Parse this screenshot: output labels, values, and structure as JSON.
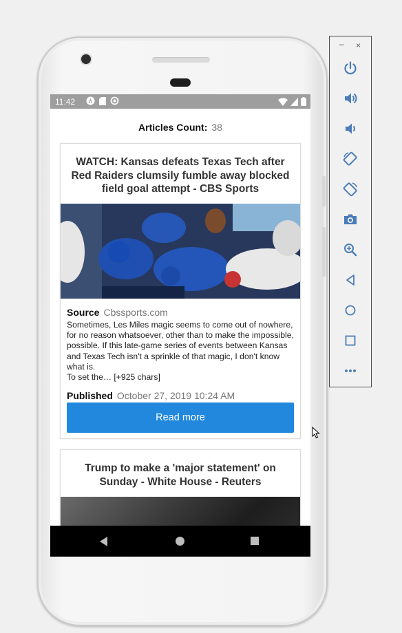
{
  "status_bar": {
    "time": "11:42",
    "icons": [
      "a-icon",
      "sd-card-icon",
      "data-saver-icon",
      "wifi-icon",
      "signal-icon",
      "battery-icon"
    ]
  },
  "header": {
    "count_label": "Articles Count:",
    "count_value": "38"
  },
  "articles": [
    {
      "title": "WATCH: Kansas defeats Texas Tech after Red Raiders clumsily fumble away blocked field goal attempt - CBS Sports",
      "source_label": "Source",
      "source_value": "Cbssports.com",
      "description": "Sometimes, Les Miles magic seems to come out of nowhere, for no reason whatsoever, other than to make the impossible, possible. If this late-game series of events between Kansas and Texas Tech isn't a sprinkle of that magic, I don't know what is.",
      "description_more": "To set the… [+925 chars]",
      "published_label": "Published",
      "published_value": "October 27, 2019 10:24 AM",
      "button_label": "Read more"
    },
    {
      "title": "Trump to make a 'major statement' on Sunday - White House - Reuters"
    }
  ],
  "colors": {
    "accent": "#2188dd",
    "status_bar": "#9e9e9e",
    "nav_bar": "#000000"
  },
  "emulator_toolbar": {
    "window_controls": [
      "minimize-icon",
      "close-icon"
    ],
    "minimize": "–",
    "close": "×",
    "buttons": [
      "power-icon",
      "volume-up-icon",
      "volume-down-icon",
      "rotate-left-icon",
      "rotate-right-icon",
      "camera-icon",
      "zoom-icon",
      "back-icon",
      "home-icon",
      "overview-icon",
      "more-icon"
    ]
  }
}
